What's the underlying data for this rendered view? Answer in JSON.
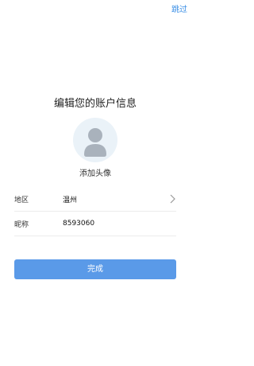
{
  "header": {
    "skip_label": "跳过"
  },
  "title": "编辑您的账户信息",
  "avatar": {
    "icon": "user-avatar-icon",
    "add_label": "添加头像"
  },
  "form": {
    "region": {
      "label": "地区",
      "value": "温州",
      "icon": "chevron-right-icon"
    },
    "nickname": {
      "label": "昵称",
      "value": "8593060"
    }
  },
  "done_label": "完成",
  "colors": {
    "accent": "#3b8fe6",
    "button": "#5a9ae8",
    "avatar_bg": "#eaf2f8",
    "avatar_fg": "#a9b2bc"
  }
}
